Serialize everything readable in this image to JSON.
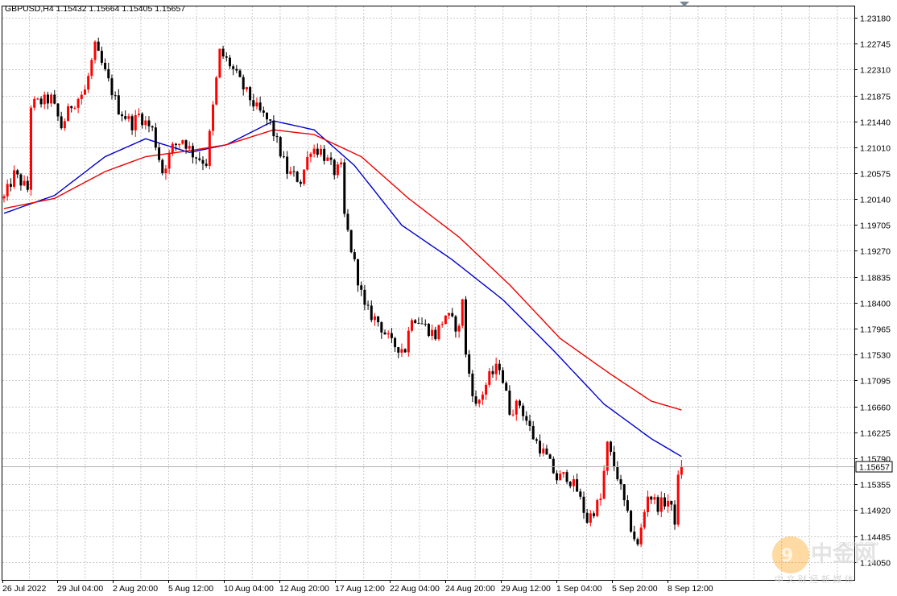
{
  "chart_data": {
    "type": "candlestick",
    "symbol_info": "GBPUSD,H4",
    "ohlc_text": "1.15432 1.15664 1.15405 1.15657",
    "current_price_label": "1.15657",
    "current_price": 1.15657,
    "y_ticks": [
      "1.23180",
      "1.22745",
      "1.22310",
      "1.21875",
      "1.21440",
      "1.21010",
      "1.20575",
      "1.20140",
      "1.19705",
      "1.19270",
      "1.18835",
      "1.18400",
      "1.17965",
      "1.17530",
      "1.17095",
      "1.16660",
      "1.16225",
      "1.15790",
      "1.15355",
      "1.14920",
      "1.14485",
      "1.14050"
    ],
    "ylim": [
      1.1375,
      1.2337
    ],
    "x_ticks": [
      "26 Jul 2022",
      "29 Jul 04:00",
      "2 Aug 20:00",
      "5 Aug 12:00",
      "10 Aug 04:00",
      "12 Aug 20:00",
      "17 Aug 12:00",
      "22 Aug 04:00",
      "24 Aug 20:00",
      "29 Aug 12:00",
      "1 Sep 04:00",
      "5 Sep 20:00",
      "8 Sep 12:00"
    ],
    "up_color": "#ff0000",
    "down_color": "#000000",
    "anchors": [
      [
        0,
        1.2015
      ],
      [
        3,
        1.2055
      ],
      [
        7,
        1.203
      ],
      [
        8,
        1.2172
      ],
      [
        14,
        1.2182
      ],
      [
        17,
        1.2135
      ],
      [
        20,
        1.2172
      ],
      [
        24,
        1.2195
      ],
      [
        27,
        1.2268
      ],
      [
        30,
        1.2225
      ],
      [
        34,
        1.2165
      ],
      [
        38,
        1.214
      ],
      [
        40,
        1.2155
      ],
      [
        44,
        1.213
      ],
      [
        47,
        1.206
      ],
      [
        50,
        1.21
      ],
      [
        53,
        1.2115
      ],
      [
        56,
        1.209
      ],
      [
        60,
        1.2075
      ],
      [
        64,
        1.226
      ],
      [
        67,
        1.224
      ],
      [
        71,
        1.22
      ],
      [
        75,
        1.2165
      ],
      [
        79,
        1.214
      ],
      [
        84,
        1.206
      ],
      [
        88,
        1.2045
      ],
      [
        91,
        1.21
      ],
      [
        94,
        1.2095
      ],
      [
        98,
        1.206
      ],
      [
        100,
        1.2065
      ],
      [
        101,
        1.1985
      ],
      [
        103,
        1.193
      ],
      [
        107,
        1.183
      ],
      [
        111,
        1.1808
      ],
      [
        115,
        1.177
      ],
      [
        119,
        1.1762
      ],
      [
        121,
        1.182
      ],
      [
        125,
        1.18
      ],
      [
        128,
        1.1785
      ],
      [
        131,
        1.182
      ],
      [
        135,
        1.1795
      ],
      [
        136,
        1.185
      ],
      [
        137,
        1.175
      ],
      [
        140,
        1.1665
      ],
      [
        144,
        1.1715
      ],
      [
        147,
        1.1735
      ],
      [
        150,
        1.166
      ],
      [
        153,
        1.167
      ],
      [
        157,
        1.1615
      ],
      [
        161,
        1.158
      ],
      [
        164,
        1.1545
      ],
      [
        167,
        1.155
      ],
      [
        170,
        1.1525
      ],
      [
        173,
        1.1475
      ],
      [
        177,
        1.151
      ],
      [
        179,
        1.16
      ],
      [
        182,
        1.155
      ],
      [
        185,
        1.148
      ],
      [
        188,
        1.143
      ],
      [
        191,
        1.152
      ],
      [
        194,
        1.15
      ],
      [
        197,
        1.1508
      ],
      [
        199,
        1.1476
      ],
      [
        200,
        1.1543
      ],
      [
        201,
        1.1566
      ]
    ],
    "ma_blue": [
      [
        0,
        1.199
      ],
      [
        15,
        1.202
      ],
      [
        30,
        1.2085
      ],
      [
        42,
        1.2115
      ],
      [
        55,
        1.2092
      ],
      [
        66,
        1.2105
      ],
      [
        80,
        1.2145
      ],
      [
        92,
        1.213
      ],
      [
        104,
        1.207
      ],
      [
        118,
        1.197
      ],
      [
        133,
        1.1912
      ],
      [
        148,
        1.1845
      ],
      [
        163,
        1.176
      ],
      [
        178,
        1.167
      ],
      [
        192,
        1.1612
      ],
      [
        201,
        1.1582
      ]
    ],
    "ma_red": [
      [
        0,
        1.1998
      ],
      [
        15,
        1.2015
      ],
      [
        30,
        1.206
      ],
      [
        42,
        1.2085
      ],
      [
        55,
        1.2095
      ],
      [
        66,
        1.2105
      ],
      [
        80,
        1.213
      ],
      [
        92,
        1.2122
      ],
      [
        106,
        1.2085
      ],
      [
        120,
        1.2015
      ],
      [
        135,
        1.195
      ],
      [
        150,
        1.187
      ],
      [
        165,
        1.178
      ],
      [
        180,
        1.172
      ],
      [
        192,
        1.1675
      ],
      [
        201,
        1.166
      ]
    ],
    "ma_blue_color": "#0000cc",
    "ma_red_color": "#ee0000"
  },
  "watermark": {
    "logo_text": "中金网",
    "url_text": "CNGOLD.COM",
    "sub_text": "中 文 财 经 新 媒 体"
  }
}
